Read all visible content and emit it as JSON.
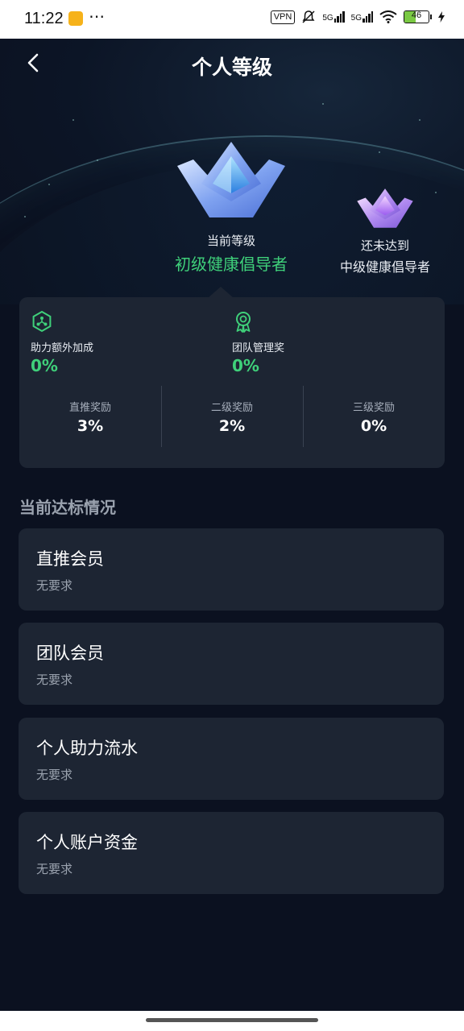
{
  "status_bar": {
    "time": "11:22",
    "vpn": "VPN",
    "sim1": "5G",
    "sim2": "5G",
    "battery": "46",
    "battery_fraction": 0.46
  },
  "header": {
    "title": "个人等级",
    "back_icon": "chevron-left-icon"
  },
  "current_level": {
    "label": "当前等级",
    "name": "初级健康倡导者"
  },
  "next_level": {
    "label": "还未达到",
    "name": "中级健康倡导者"
  },
  "benefits": [
    {
      "label": "助力额外加成",
      "value": "0%",
      "icon": "boost-icon"
    },
    {
      "label": "团队管理奖",
      "value": "0%",
      "icon": "award-icon"
    }
  ],
  "rewards": [
    {
      "label": "直推奖励",
      "value": "3%"
    },
    {
      "label": "二级奖励",
      "value": "2%"
    },
    {
      "label": "三级奖励",
      "value": "0%"
    }
  ],
  "section_title": "当前达标情况",
  "requirements": [
    {
      "name": "直推会员",
      "desc": "无要求"
    },
    {
      "name": "团队会员",
      "desc": "无要求"
    },
    {
      "name": "个人助力流水",
      "desc": "无要求"
    },
    {
      "name": "个人账户资金",
      "desc": "无要求"
    }
  ],
  "colors": {
    "background": "#0b1120",
    "card": "#1d2533",
    "accent_green": "#3fd07a",
    "muted_text": "#9aa2ae"
  }
}
